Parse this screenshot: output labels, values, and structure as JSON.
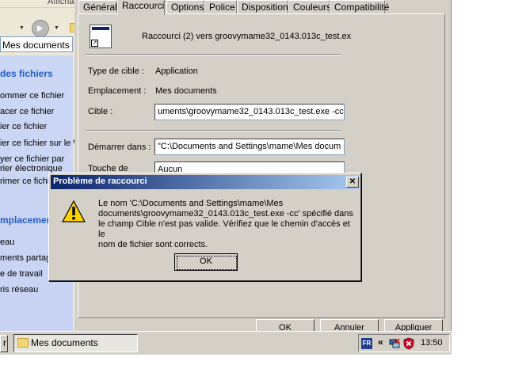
{
  "explorer": {
    "menu_partial": "Affichage",
    "address_value": "Mes documents",
    "task_sections": [
      {
        "header": "des fichiers",
        "items": [
          "ommer ce fichier",
          "acer ce fichier",
          "ier ce fichier",
          "ier ce fichier sur le W",
          "yer ce fichier par",
          "rier électronique",
          "rimer ce fichi"
        ]
      },
      {
        "header": "mplacemen",
        "items": [
          "eau",
          "ments partag",
          "e de travail",
          "ris réseau"
        ]
      }
    ]
  },
  "properties": {
    "tabs": [
      "Général",
      "Raccourci",
      "Options",
      "Police",
      "Disposition",
      "Couleurs",
      "Compatibilité"
    ],
    "active_tab": "Raccourci",
    "shortcut_name": "Raccourci (2) vers groovymame32_0143.013c_test.ex",
    "target_type_label": "Type de cible :",
    "target_type_value": "Application",
    "location_label": "Emplacement :",
    "location_value": "Mes documents",
    "target_label": "Cible :",
    "target_value": "uments\\groovymame32_0143.013c_test.exe -cc\"",
    "start_in_label": "Démarrer dans :",
    "start_in_value": "\"C:\\Documents and Settings\\mame\\Mes docum",
    "shortcut_key_label": "Touche de",
    "shortcut_key_value": "Aucun",
    "buttons": {
      "ok": "OK",
      "cancel": "Annuler",
      "apply": "Appliquer"
    }
  },
  "error_dialog": {
    "title": "Problème de raccourci",
    "close_glyph": "✕",
    "message": "Le nom 'C:\\Documents and Settings\\mame\\Mes\ndocuments\\groovymame32_0143.013c_test.exe -cc' spécifié dans\nle champ Cible n'est pas valide. Vérifiez que le chemin d'accès et le\nnom de fichier sont corrects.",
    "ok_label": "OK",
    "icon": "warning-icon"
  },
  "taskbar": {
    "start_partial": "r",
    "task_label": "Mes documents",
    "language": "FR",
    "tray_chevron": "«",
    "clock": "13:50"
  }
}
